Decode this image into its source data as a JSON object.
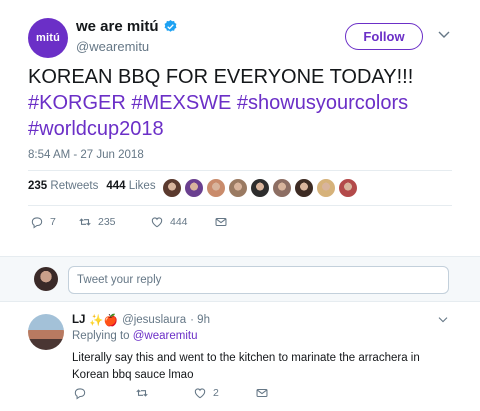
{
  "tweet": {
    "avatar_text": "mitú",
    "author_name": "we are mitú",
    "author_handle": "@wearemitu",
    "follow_label": "Follow",
    "text_line": "KOREAN BBQ FOR EVERYONE TODAY!!!",
    "hashtags_line1": "#KORGER #MEXSWE #showusyourcolors",
    "hashtags_line2": "#worldcup2018",
    "timestamp": "8:54 AM - 27 Jun 2018",
    "retweets_count": "235",
    "retweets_label": "Retweets",
    "likes_count": "444",
    "likes_label": "Likes",
    "actions": {
      "replies": "7",
      "retweets": "235",
      "likes": "444"
    },
    "liker_face_colors": [
      "#5b3a2e",
      "#6a3f8f",
      "#c98b6b",
      "#9a7a62",
      "#2d2d2d",
      "#8d6e63",
      "#3d2b23",
      "#d6b27a",
      "#b34a4a"
    ]
  },
  "reply_box": {
    "placeholder": "Tweet your reply"
  },
  "reply": {
    "name": "LJ",
    "emoji": "✨🍎",
    "handle": "@jesuslaura",
    "time": "· 9h",
    "replying_prefix": "Replying to",
    "replying_to": "@wearemitu",
    "text": "Literally say this and went to the kitchen to marinate the arrachera in Korean bbq sauce lmao",
    "likes": "2"
  },
  "colors": {
    "accent": "#6b2fc7",
    "muted": "#657786",
    "text": "#14171a",
    "verified": "#1da1f2"
  }
}
